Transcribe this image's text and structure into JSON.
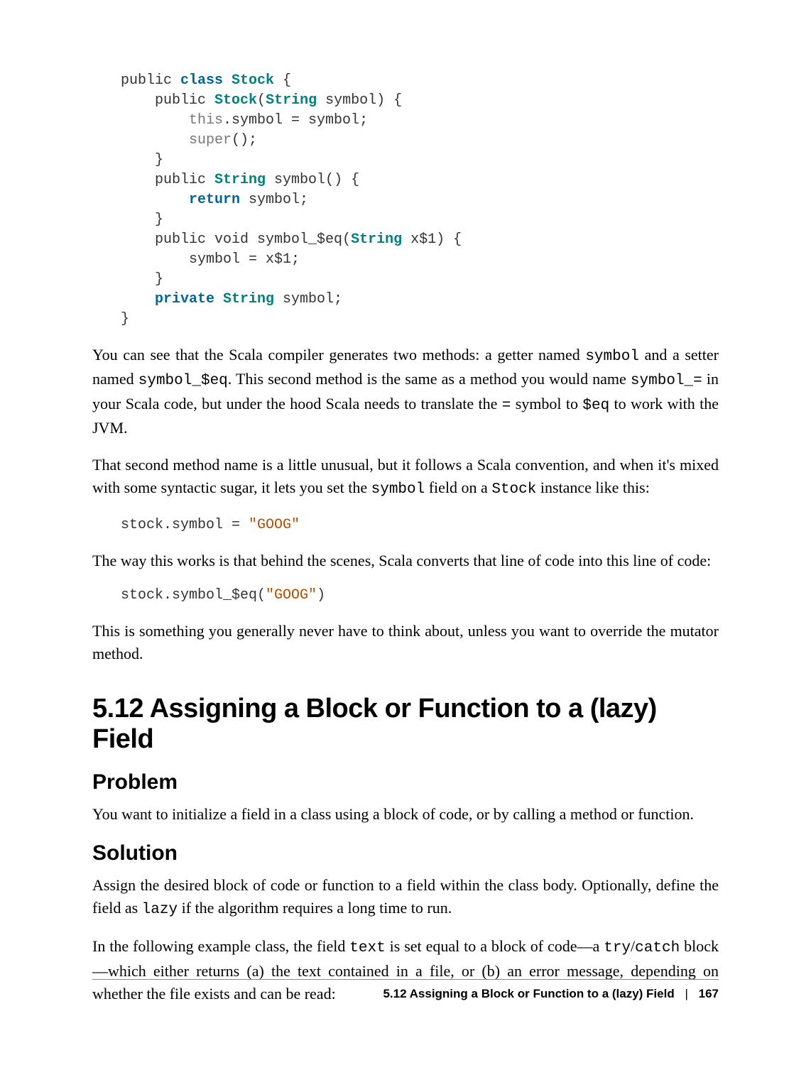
{
  "code1": {
    "l1a": "public ",
    "l1b": "class ",
    "l1c": "Stock ",
    "l1d": "{",
    "l2a": "    public ",
    "l2b": "Stock",
    "l2c": "(",
    "l2d": "String",
    "l2e": " symbol) {",
    "l3a": "        ",
    "l3b": "this",
    "l3c": ".symbol = symbol;",
    "l4a": "        ",
    "l4b": "super",
    "l4c": "();",
    "l5": "    }",
    "l6a": "    public ",
    "l6b": "String",
    "l6c": " symbol() {",
    "l7a": "        ",
    "l7b": "return",
    "l7c": " symbol;",
    "l8": "    }",
    "l9a": "    public void symbol_$eq(",
    "l9b": "String",
    "l9c": " x$1) {",
    "l10": "        symbol = x$1;",
    "l11": "    }",
    "l12a": "    ",
    "l12b": "private ",
    "l12c": "String",
    "l12d": " symbol;",
    "l13": "}"
  },
  "p1": {
    "t1": "You can see that the Scala compiler generates two methods: a getter named ",
    "c1": "symbol",
    "t2": " and a setter named ",
    "c2": "symbol_$eq",
    "t3": ". This second method is the same as a method you would name ",
    "c3": "symbol_=",
    "t4": " in your Scala code, but under the hood Scala needs to translate the ",
    "c4": "=",
    "t5": " symbol to ",
    "c5": "$eq",
    "t6": " to work with the JVM."
  },
  "p2": {
    "t1": "That second method name is a little unusual, but it follows a Scala convention, and when it's mixed with some syntactic sugar, it lets you set the ",
    "c1": "symbol",
    "t2": " field on a ",
    "c2": "Stock",
    "t3": " instance like this:"
  },
  "code2": {
    "l1a": "stock.symbol = ",
    "l1b": "\"GOOG\""
  },
  "p3": "The way this works is that behind the scenes, Scala converts that line of code into this line of code:",
  "code3": {
    "l1a": "stock.symbol_$eq(",
    "l1b": "\"GOOG\"",
    "l1c": ")"
  },
  "p4": "This is something you generally never have to think about, unless you want to over­ride the mutator method.",
  "h1": "5.12 Assigning a Block or Function to a (lazy) Field",
  "h2a": "Problem",
  "p5": "You want to initialize a field in a class using a block of code, or by calling a method or function.",
  "h2b": "Solution",
  "p6": {
    "t1": "Assign the desired block of code or function to a field within the class body. Option­ally, define the field as ",
    "c1": "lazy",
    "t2": " if the algorithm requires a long time to run."
  },
  "p7": {
    "t1": "In the following example class, the field ",
    "c1": "text",
    "t2": " is set equal to a block of code—a ",
    "c2": "try",
    "t3": "/",
    "c3": "catch",
    "t4": " block—which either returns (a) the text contained in a file, or (b) an error mes­sage, depending on whether the file exists and can be read:"
  },
  "footer": {
    "title": "5.12 Assigning a Block or Function to a (lazy) Field",
    "sep": "|",
    "page": "167"
  }
}
